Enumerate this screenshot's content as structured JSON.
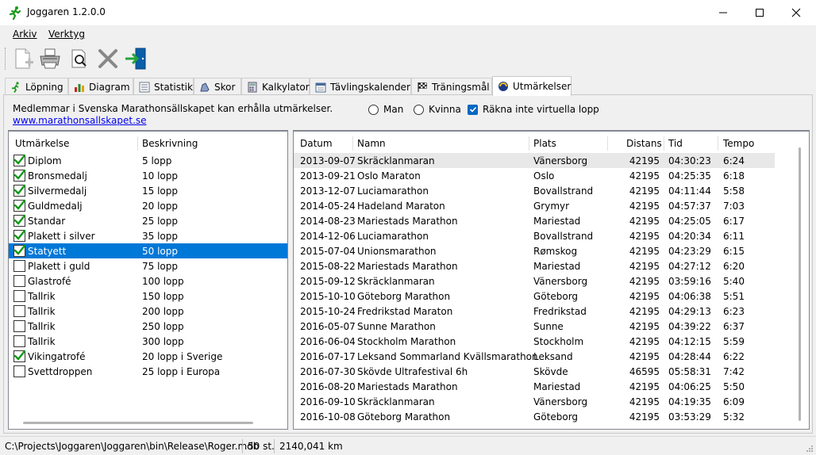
{
  "window": {
    "title": "Joggaren 1.2.0.0"
  },
  "menu": {
    "items": [
      {
        "label": "Arkiv"
      },
      {
        "label": "Verktyg"
      }
    ]
  },
  "toolbar": {
    "buttons": [
      {
        "icon": "new-document-icon"
      },
      {
        "icon": "printer-icon"
      },
      {
        "icon": "print-preview-icon"
      },
      {
        "icon": "delete-icon"
      },
      {
        "icon": "exit-icon"
      }
    ]
  },
  "tabs": [
    {
      "label": "Löpning",
      "icon": "runner-icon"
    },
    {
      "label": "Diagram",
      "icon": "bar-chart-icon"
    },
    {
      "label": "Statistik",
      "icon": "statistics-icon"
    },
    {
      "label": "Skor",
      "icon": "shoe-icon"
    },
    {
      "label": "Kalkylator",
      "icon": "calculator-icon"
    },
    {
      "label": "Tävlingskalender",
      "icon": "calendar-icon"
    },
    {
      "label": "Träningsmål",
      "icon": "checkered-flag-icon"
    },
    {
      "label": "Utmärkelser",
      "icon": "medal-icon"
    }
  ],
  "active_tab": "Utmärkelser",
  "panel": {
    "info_text": "Medlemmar i Svenska Marathonsällskapet kan erhålla utmärkelser.",
    "link_text": "www.marathonsallskapet.se",
    "radio_man": "Man",
    "radio_kvinna": "Kvinna",
    "checkbox_label": "Räkna inte virtuella lopp",
    "checkbox_checked": true
  },
  "awards": {
    "columns": [
      "Utmärkelse",
      "Beskrivning"
    ],
    "selected_index": 6,
    "rows": [
      {
        "name": "Diplom",
        "desc": "5 lopp",
        "checked": true
      },
      {
        "name": "Bronsmedalj",
        "desc": "10 lopp",
        "checked": true
      },
      {
        "name": "Silvermedalj",
        "desc": "15 lopp",
        "checked": true
      },
      {
        "name": "Guldmedalj",
        "desc": "20 lopp",
        "checked": true
      },
      {
        "name": "Standar",
        "desc": "25 lopp",
        "checked": true
      },
      {
        "name": "Plakett i silver",
        "desc": "35 lopp",
        "checked": true
      },
      {
        "name": "Statyett",
        "desc": "50 lopp",
        "checked": true
      },
      {
        "name": "Plakett i guld",
        "desc": "75 lopp",
        "checked": false
      },
      {
        "name": "Glastrofé",
        "desc": "100 lopp",
        "checked": false
      },
      {
        "name": "Tallrik",
        "desc": "150 lopp",
        "checked": false
      },
      {
        "name": "Tallrik",
        "desc": "200 lopp",
        "checked": false
      },
      {
        "name": "Tallrik",
        "desc": "250 lopp",
        "checked": false
      },
      {
        "name": "Tallrik",
        "desc": "300 lopp",
        "checked": false
      },
      {
        "name": "Vikingatrofé",
        "desc": "20 lopp i Sverige",
        "checked": true
      },
      {
        "name": "Svettdroppen",
        "desc": "25 lopp i Europa",
        "checked": false
      }
    ]
  },
  "races": {
    "columns": [
      "Datum",
      "Namn",
      "Plats",
      "Distans",
      "Tid",
      "Tempo"
    ],
    "rows": [
      [
        "2013-09-07",
        "Skräcklanmaran",
        "Vänersborg",
        "42195",
        "04:30:23",
        "6:24"
      ],
      [
        "2013-09-21",
        "Oslo Maraton",
        "Oslo",
        "42195",
        "04:25:35",
        "6:18"
      ],
      [
        "2013-12-07",
        "Luciamarathon",
        "Bovallstrand",
        "42195",
        "04:11:44",
        "5:58"
      ],
      [
        "2014-05-24",
        "Hadeland Maraton",
        "Grymyr",
        "42195",
        "04:57:37",
        "7:03"
      ],
      [
        "2014-08-23",
        "Mariestads Marathon",
        "Mariestad",
        "42195",
        "04:25:05",
        "6:17"
      ],
      [
        "2014-12-06",
        "Luciamarathon",
        "Bovallstrand",
        "42195",
        "04:20:34",
        "6:11"
      ],
      [
        "2015-07-04",
        "Unionsmarathon",
        "Rømskog",
        "42195",
        "04:23:29",
        "6:15"
      ],
      [
        "2015-08-22",
        "Mariestads Marathon",
        "Mariestad",
        "42195",
        "04:27:12",
        "6:20"
      ],
      [
        "2015-09-12",
        "Skräcklanmaran",
        "Vänersborg",
        "42195",
        "03:59:16",
        "5:40"
      ],
      [
        "2015-10-10",
        "Göteborg Marathon",
        "Göteborg",
        "42195",
        "04:06:38",
        "5:51"
      ],
      [
        "2015-10-24",
        "Fredrikstad Maraton",
        "Fredrikstad",
        "42195",
        "04:29:13",
        "6:23"
      ],
      [
        "2016-05-07",
        "Sunne Marathon",
        "Sunne",
        "42195",
        "04:39:22",
        "6:37"
      ],
      [
        "2016-06-04",
        "Stockholm Marathon",
        "Stockholm",
        "42195",
        "04:12:15",
        "5:59"
      ],
      [
        "2016-07-17",
        "Leksand Sommarland Kvällsmarathon",
        "Leksand",
        "42195",
        "04:28:44",
        "6:22"
      ],
      [
        "2016-07-30",
        "Skövde Ultrafestival 6h",
        "Skövde",
        "46595",
        "05:58:31",
        "7:42"
      ],
      [
        "2016-08-20",
        "Mariestads Marathon",
        "Mariestad",
        "42195",
        "04:06:25",
        "5:50"
      ],
      [
        "2016-09-10",
        "Skräcklanmaran",
        "Vänersborg",
        "42195",
        "04:19:35",
        "6:09"
      ],
      [
        "2016-10-08",
        "Göteborg Marathon",
        "Göteborg",
        "42195",
        "03:53:29",
        "5:32"
      ]
    ]
  },
  "status": {
    "path": "C:\\Projects\\Joggaren\\Joggaren\\bin\\Release\\Roger.mdb",
    "count": "50 st.",
    "distance": "2140,041 km"
  }
}
